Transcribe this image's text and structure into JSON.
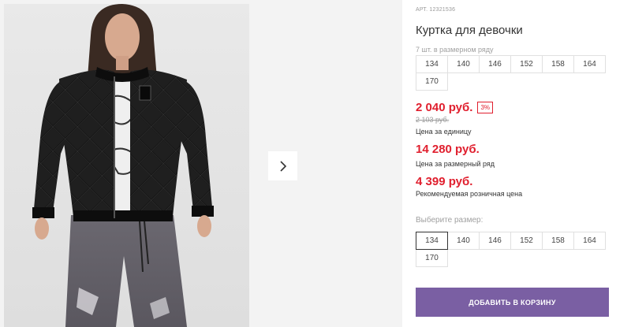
{
  "product": {
    "sku_text": "АРТ. 12321536",
    "title": "Куртка для девочки",
    "series_note": "7 шт. в размерном ряду"
  },
  "series_sizes": [
    "134",
    "140",
    "146",
    "152",
    "158",
    "164",
    "170"
  ],
  "pricing": {
    "unit_price": "2 040 руб.",
    "discount_badge": "3%",
    "old_price": "2 103 руб.",
    "unit_caption": "Цена за единицу",
    "series_price": "14 280 руб.",
    "series_caption": "Цена за размерный ряд",
    "retail_price": "4 399 руб.",
    "retail_caption": "Рекомендуемая розничная цена"
  },
  "size_selector": {
    "label": "Выберите размер:",
    "options": [
      "134",
      "140",
      "146",
      "152",
      "158",
      "164",
      "170"
    ],
    "selected": "134"
  },
  "actions": {
    "add_to_cart_label": "ДОБАВИТЬ В КОРЗИНУ"
  },
  "gallery": {
    "next_icon": "chevron-right-icon"
  },
  "colors": {
    "accent_button": "#7a5fa3",
    "price_red": "#e01f2e"
  }
}
